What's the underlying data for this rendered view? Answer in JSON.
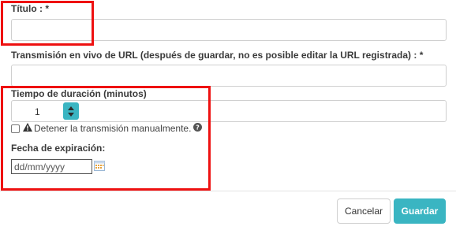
{
  "form": {
    "title_label": "Título : *",
    "title_value": "",
    "url_label": "Transmisión en vivo de URL (después de guardar, no es posible editar la URL registrada) : *",
    "url_value": "",
    "duration_label": "Tiempo de duración (minutos)",
    "duration_value": "1",
    "manual_stop_label": "Detener la transmisión manualmente.",
    "manual_stop_checked": false,
    "expiration_label": "Fecha de expiración:",
    "expiration_placeholder": "dd/mm/yyyy"
  },
  "footer": {
    "cancel_label": "Cancelar",
    "save_label": "Guardar"
  },
  "annotations": {
    "highlight_color": "#ee1111"
  },
  "colors": {
    "accent": "#3ab5c2"
  },
  "icons": {
    "warning": "warning-icon",
    "help": "help-icon",
    "calendar": "calendar-icon"
  }
}
